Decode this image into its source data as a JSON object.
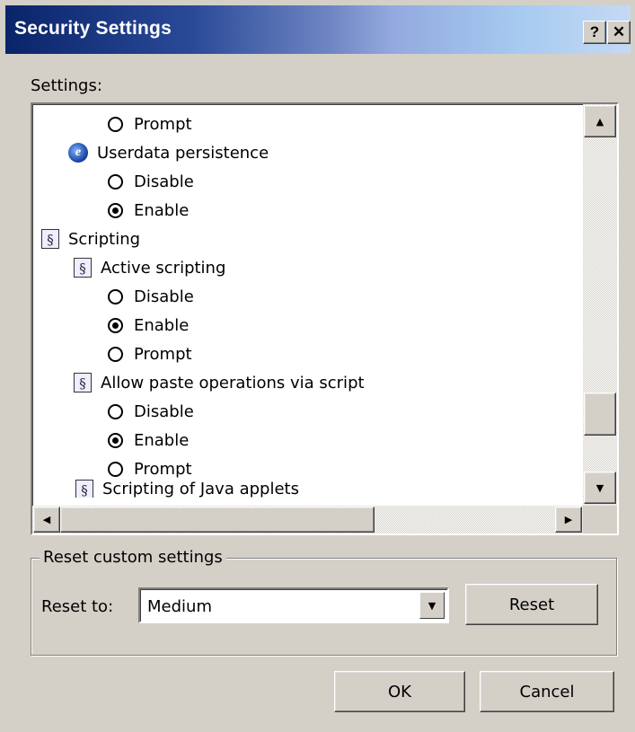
{
  "window": {
    "title": "Security Settings",
    "help_button": "?",
    "close_button": "✕"
  },
  "settings_label": "Settings:",
  "tree": [
    {
      "type": "radio",
      "label": "Prompt",
      "checked": false
    },
    {
      "type": "setting",
      "icon": "ie-icon",
      "label": "Userdata persistence"
    },
    {
      "type": "radio",
      "label": "Disable",
      "checked": false
    },
    {
      "type": "radio",
      "label": "Enable",
      "checked": true
    },
    {
      "type": "category",
      "icon": "script-icon",
      "label": "Scripting"
    },
    {
      "type": "setting",
      "icon": "script-icon",
      "label": "Active scripting"
    },
    {
      "type": "radio",
      "label": "Disable",
      "checked": false
    },
    {
      "type": "radio",
      "label": "Enable",
      "checked": true
    },
    {
      "type": "radio",
      "label": "Prompt",
      "checked": false
    },
    {
      "type": "setting",
      "icon": "script-icon",
      "label": "Allow paste operations via script"
    },
    {
      "type": "radio",
      "label": "Disable",
      "checked": false
    },
    {
      "type": "radio",
      "label": "Enable",
      "checked": true
    },
    {
      "type": "radio",
      "label": "Prompt",
      "checked": false
    },
    {
      "type": "setting",
      "icon": "script-icon",
      "label": "Scripting of Java applets"
    }
  ],
  "reset_group": {
    "title": "Reset custom settings",
    "reset_to_label": "Reset to:",
    "selected_level": "Medium",
    "reset_button": "Reset"
  },
  "footer": {
    "ok": "OK",
    "cancel": "Cancel"
  }
}
